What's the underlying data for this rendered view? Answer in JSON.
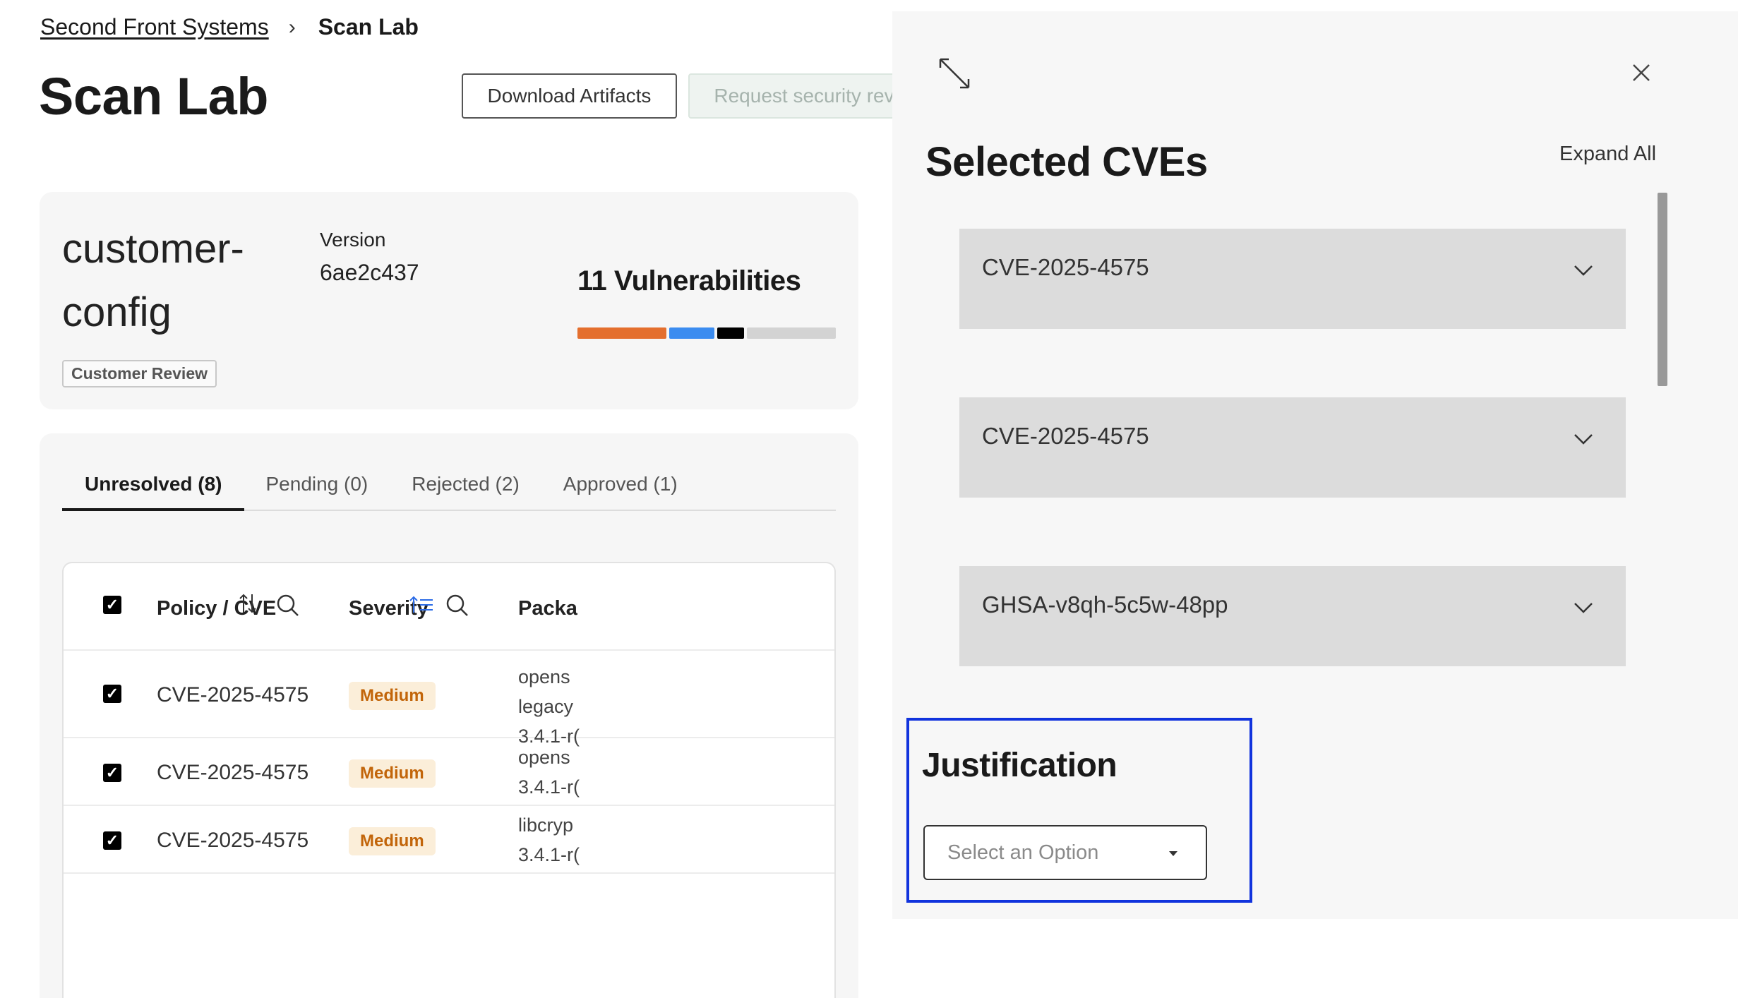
{
  "breadcrumb": {
    "org": "Second Front Systems",
    "separator": "›",
    "current": "Scan Lab"
  },
  "page_title": "Scan Lab",
  "buttons": {
    "download": "Download Artifacts",
    "request_review": "Request security review"
  },
  "app": {
    "name": "customer-config",
    "version_label": "Version",
    "version": "6ae2c437",
    "status": "Customer Review",
    "vuln_count": "11 Vulnerabilities",
    "severity_colors": {
      "high": "#e46f2e",
      "medium": "#3b8cf0",
      "critical": "#000000",
      "other": "#d3d3d3"
    }
  },
  "tabs": [
    {
      "label": "Unresolved (8)",
      "active": true
    },
    {
      "label": "Pending (0)",
      "active": false
    },
    {
      "label": "Rejected (2)",
      "active": false
    },
    {
      "label": "Approved (1)",
      "active": false
    }
  ],
  "table": {
    "headers": {
      "policy": "Policy / CVE",
      "severity": "Severity",
      "package": "Packa"
    },
    "rows": [
      {
        "cve": "CVE-2025-4575",
        "severity": "Medium",
        "package": [
          "opens",
          "legacy",
          "3.4.1-r("
        ]
      },
      {
        "cve": "CVE-2025-4575",
        "severity": "Medium",
        "package": [
          "opens",
          "3.4.1-r("
        ]
      },
      {
        "cve": "CVE-2025-4575",
        "severity": "Medium",
        "package": [
          "libcryp",
          "3.4.1-r("
        ]
      }
    ]
  },
  "side_panel": {
    "title": "Selected CVEs",
    "expand_all": "Expand All",
    "cves": [
      "CVE-2025-4575",
      "CVE-2025-4575",
      "GHSA-v8qh-5c5w-48pp"
    ],
    "justification": {
      "title": "Justification",
      "placeholder": "Select an Option"
    }
  }
}
